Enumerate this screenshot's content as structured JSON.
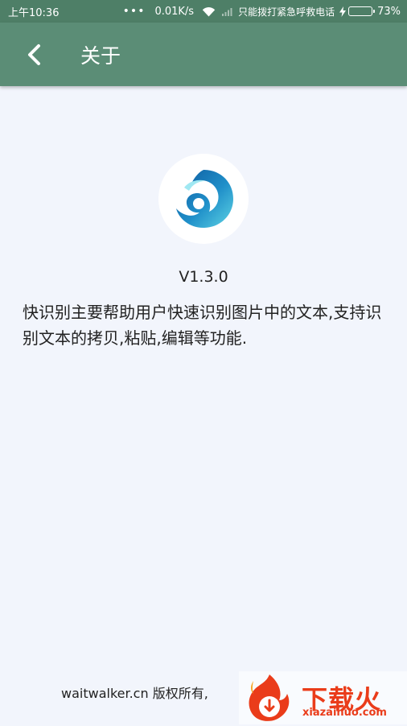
{
  "status_bar": {
    "time": "上午10:36",
    "dots": "•••",
    "network_speed": "0.01K/s",
    "carrier": "只能拨打紧急呼救电话",
    "battery_percent": "73%",
    "battery_level": 0.73,
    "battery_color": "#4cd964"
  },
  "app_bar": {
    "back_icon": "chevron-left-icon",
    "title": "关于",
    "color": "#5b8d76"
  },
  "about": {
    "logo_icon": "wave-logo-icon",
    "version": "V1.3.0",
    "description": "快识别主要帮助用户快速识别图片中的文本,支持识别文本的拷贝,粘贴,编辑等功能.",
    "copyright": "waitwalker.cn 版权所有,"
  },
  "watermark": {
    "brand": "下载火",
    "domain": "xiazaihuo.com",
    "color": "#ea3c1a"
  }
}
